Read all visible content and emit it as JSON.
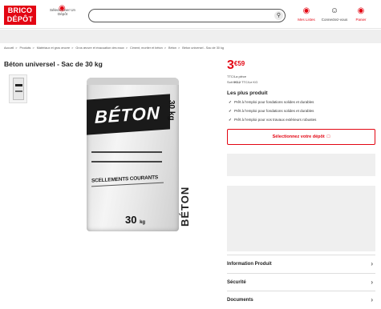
{
  "header": {
    "logo_line1": "BRICO",
    "logo_line2": "DÉPÔT",
    "store_selector": "Sélectionner Un Dépôt",
    "store_icon": "map-pin-icon",
    "search_icon": "search-icon",
    "lists_label": "Mes Listes",
    "account_label": "Connectez-vous",
    "cart_label": "Panier"
  },
  "breadcrumb": [
    "Accueil",
    "Produits",
    "Matériaux et gros œuvre",
    "Gros œuvre et évacuation des eaux",
    "Ciment, mortier et béton",
    "Béton",
    "Béton universel - Sac de 30 kg"
  ],
  "product": {
    "title": "Béton universel - Sac de 30 kg",
    "bag_brand": "BÉTON",
    "bag_subtitle": "SCELLEMENTS COURANTS",
    "bag_weight": "30",
    "bag_weight_unit": "kg",
    "bag_side_weight": "30 kg",
    "bag_vertical": "BÉTON"
  },
  "pricing": {
    "price_int": "3",
    "price_dec": "€59",
    "unit": "TTC/La pièce",
    "per_kg_prefix": "Soit",
    "per_kg_value": "0€12",
    "per_kg_suffix": "TTC/Le KG"
  },
  "highlights": {
    "heading": "Les plus produit",
    "items": [
      "Prêt à l'emploi pour fondations solides et durables",
      "Prêt à l'emploi pour fondations solides et durables",
      "Prêt à l'emploi pour vos travaux extérieurs robustes"
    ]
  },
  "store_button": "Sélectionnez votre dépôt",
  "accordion": [
    {
      "label": "Information Produit"
    },
    {
      "label": "Sécurité"
    },
    {
      "label": "Documents"
    }
  ],
  "colors": {
    "brand": "#e30613",
    "panel": "#efefef"
  }
}
